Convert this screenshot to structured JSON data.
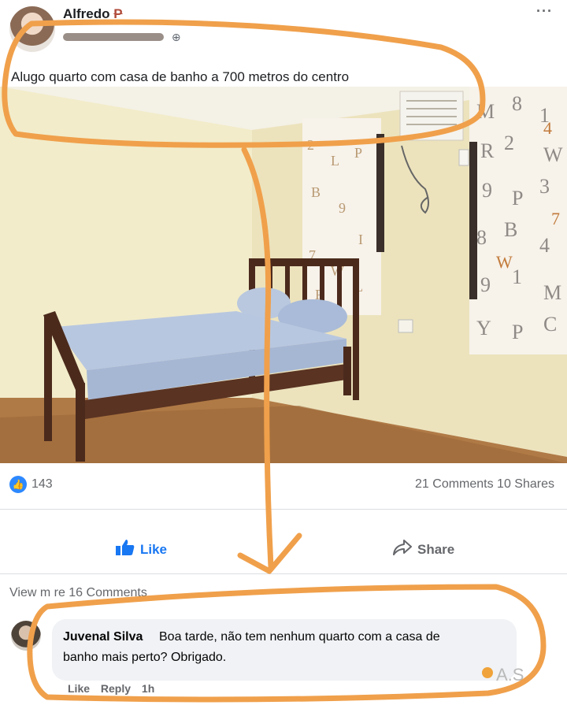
{
  "post": {
    "author_visible": "Alfredo",
    "author_scribbled": "P",
    "caption": "Alugo quarto com casa de banho a 700 metros do centro",
    "more_icon": "···"
  },
  "stats": {
    "likes": "143",
    "comments_shares": "21 Comments 10 Shares"
  },
  "actions": {
    "like_label": "Like",
    "share_label": "Share"
  },
  "comments": {
    "view_more": "View m    re 16 Comments",
    "items": [
      {
        "name": "Juvenal Silva",
        "line1": "Boa tarde, não tem nenhum quarto com a casa de",
        "line2": "banho mais perto? Obrigado.",
        "actions": [
          "Like",
          "Reply",
          "1h"
        ]
      }
    ]
  },
  "watermark": "A.S.",
  "colors": {
    "accent_blue": "#1877f2",
    "annotation_orange": "#f0a04b"
  }
}
